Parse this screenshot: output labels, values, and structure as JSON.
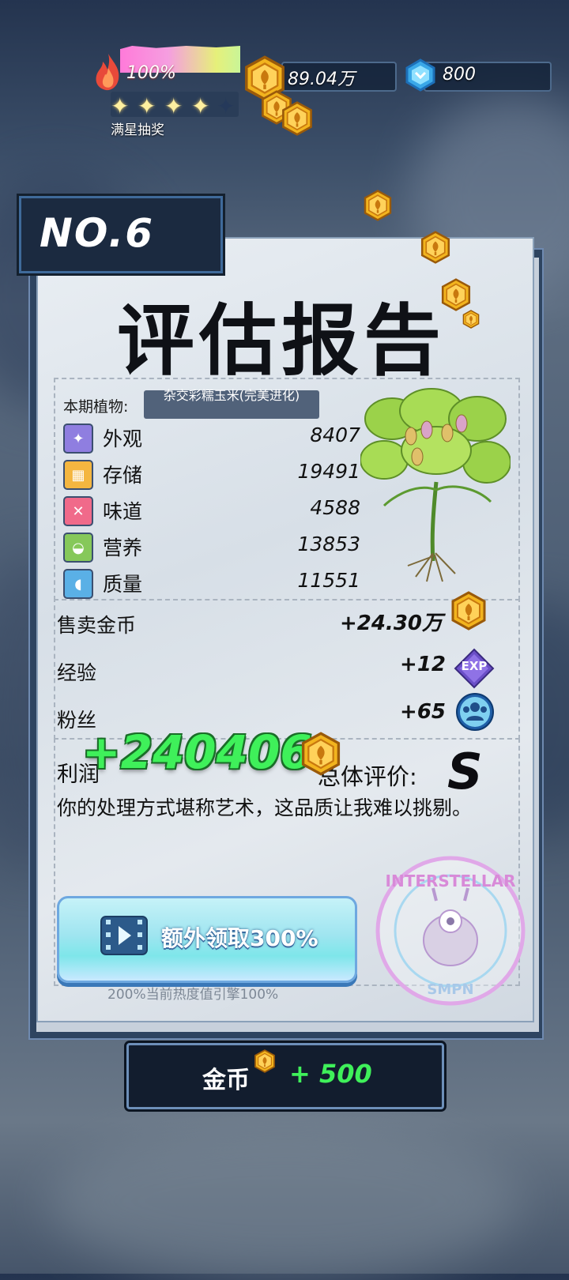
{
  "hud": {
    "heat_percent": "100%",
    "heat_level": 1.0,
    "star_count": 4,
    "star_total": 5,
    "full_star_label": "满星抽奖",
    "gold_amount": "89.04万",
    "gem_amount": "800"
  },
  "report": {
    "number": "NO.6",
    "title": "评估报告",
    "plant_label": "本期植物:",
    "plant_name": "杂交彩糯玉米(完美进化)",
    "stats": [
      {
        "label": "外观",
        "value": "8407",
        "icon": "sparkle-icon",
        "color": "#8f7ee0"
      },
      {
        "label": "存储",
        "value": "19491",
        "icon": "box-icon",
        "color": "#f4b640"
      },
      {
        "label": "味道",
        "value": "4588",
        "icon": "utensils-icon",
        "color": "#f06a8a"
      },
      {
        "label": "营养",
        "value": "13853",
        "icon": "nutrition-icon",
        "color": "#86c85a"
      },
      {
        "label": "质量",
        "value": "11551",
        "icon": "muscle-icon",
        "color": "#5ab0e6"
      }
    ],
    "rewards": [
      {
        "label": "售卖金币",
        "value": "+24.30万",
        "icon": "coin-icon"
      },
      {
        "label": "经验",
        "value": "+12",
        "icon": "exp-icon",
        "icon_text": "EXP"
      },
      {
        "label": "粉丝",
        "value": "+65",
        "icon": "fans-icon"
      }
    ],
    "profit_label": "利润",
    "profit_value": "+240406",
    "overall_label": "总体评价:",
    "grade": "S",
    "comment": "你的处理方式堪称艺术，这品质让我难以挑剔。",
    "extra_button_label": "额外领取300%",
    "heat_note": "200%当前热度值引擎100%",
    "stamp_text_top": "INTERSTELLAR",
    "stamp_text_bottom": "SMPN"
  },
  "footer": {
    "gold_label": "金币",
    "gold_bonus": "+ 500"
  },
  "colors": {
    "accent_green": "#3ff05a",
    "panel_dark": "#1b2a40",
    "coin_gold": "#f2b41e"
  }
}
